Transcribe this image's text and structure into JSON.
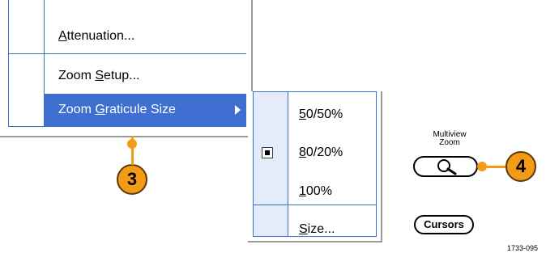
{
  "menu": {
    "items": [
      {
        "label": "Attenuation...",
        "mnemonic": "A",
        "rest": "ttenuation..."
      },
      {
        "label": "Zoom Setup...",
        "pre": "Zoom ",
        "mnemonic": "S",
        "rest": "etup..."
      },
      {
        "label": "Zoom Graticule Size",
        "pre": "Zoom ",
        "mnemonic": "G",
        "rest": "raticule Size",
        "highlighted": true
      }
    ]
  },
  "submenu": {
    "items": [
      {
        "label": "50/50%",
        "mnemonic": "5",
        "rest": "0/50%",
        "checked": false
      },
      {
        "label": "80/20%",
        "mnemonic": "8",
        "rest": "0/20%",
        "checked": true
      },
      {
        "label": "100%",
        "mnemonic": "1",
        "rest": "00%",
        "checked": false
      },
      {
        "label": "Size...",
        "mnemonic": "S",
        "rest": "ize...",
        "checked": false
      }
    ]
  },
  "callouts": {
    "step3": "3",
    "step4": "4"
  },
  "buttons": {
    "multiview_zoom_line1": "Multiview",
    "multiview_zoom_line2": "Zoom",
    "cursors": "Cursors"
  },
  "figure_number": "1733-095",
  "colors": {
    "highlight": "#3f6fd1",
    "callout": "#f39a17",
    "gutter": "#e4ecf9"
  }
}
